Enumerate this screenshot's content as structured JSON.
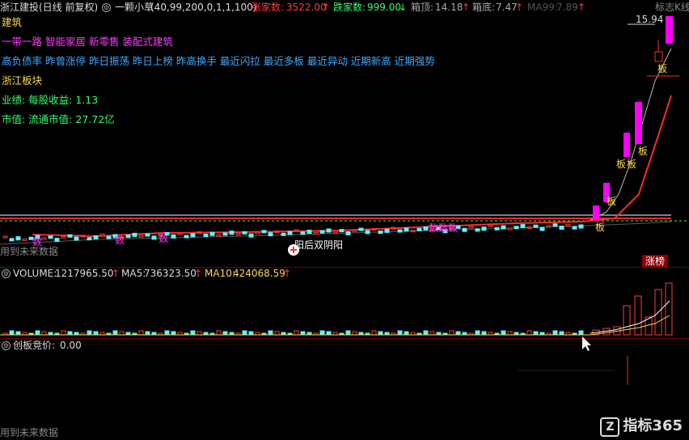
{
  "header": {
    "title": "浙江建投(日线 前复权)",
    "indicator_name": "一颗小草",
    "indicator_params": "(40,99,200,0,1,1,100)",
    "rise_count_label": "张家数:",
    "rise_count": "3522.00",
    "fall_count_label": "跌家数:",
    "fall_count": "999.00",
    "box_top_label": "箱顶:",
    "box_top": "14.18",
    "box_bottom_label": "箱底:",
    "box_bottom": "7.47",
    "ma99_label": "MA99:",
    "ma99": "7.89",
    "right_label": "标志K线"
  },
  "info_lines": {
    "industry": "建筑",
    "concepts": "一带一路 智能家居 新零售 装配式建筑",
    "signals": "高负债率 昨曾涨停 昨日振荡 昨日上榜 昨高换手 最近闪拉 最近多板 最近异动 近期新高 近期强势",
    "sector": "浙江板块",
    "performance": "业绩: 每股收益: 1.13",
    "market_cap": "市值: 流通市值: 27.72亿"
  },
  "main_chart": {
    "price_high_label": "15.94",
    "pattern_label": "阳后双阴阳",
    "future_note": "用到未来数据",
    "limit_tag": "涨榜",
    "board_tags": [
      "板",
      "板",
      "板",
      "板",
      "板"
    ],
    "buy_tags": [
      "数",
      "数",
      "数",
      "数数数"
    ]
  },
  "volume_panel": {
    "label": "VOLUME:",
    "volume": "1217965.50",
    "ma5_label": "MA5:",
    "ma5": "736323.50",
    "ma10_label": "MA10:",
    "ma10": "424068.59"
  },
  "auction_panel": {
    "label": "创板竞价:",
    "value": "0.00",
    "future_note": "用到未来数据"
  },
  "logo": {
    "text": "指标365"
  },
  "colors": {
    "up": "#ff3b3b",
    "down": "#32ff6a",
    "magenta": "#ff00ff",
    "cyan": "#5ef3ff",
    "yellow": "#ffd84a",
    "blue_text": "#3fa9ff"
  },
  "chart_data": {
    "type": "candlestick",
    "volume": [
      5,
      6,
      6,
      7,
      8,
      9,
      8,
      10,
      12,
      60,
      90,
      110,
      130
    ],
    "limit_up_closes": [
      9.6,
      10.6,
      11.6,
      12.8,
      14.1,
      15.6
    ]
  }
}
